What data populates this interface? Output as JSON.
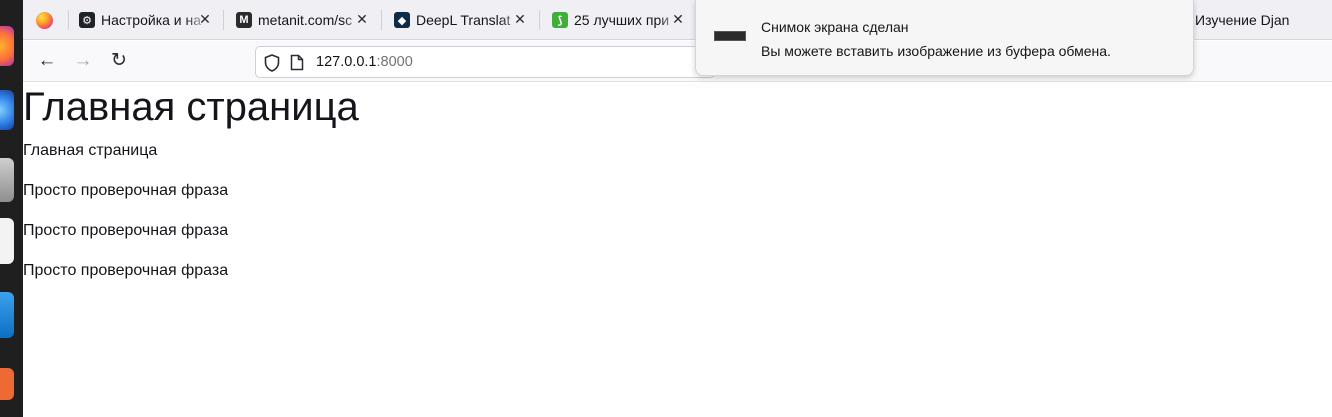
{
  "browser": {
    "tabs": [
      {
        "title": "Настройка и на",
        "icon": "github-icon",
        "favicon_color": "#1f2328",
        "favicon_glyph": "⚙"
      },
      {
        "title": "metanit.com/sc",
        "icon": "metanit-icon",
        "favicon_color": "#2b2b2b",
        "favicon_glyph": "M"
      },
      {
        "title": "DeepL Translat",
        "icon": "deepl-icon",
        "favicon_color": "#0f2b46",
        "favicon_glyph": "◆"
      },
      {
        "title": "25 лучших при",
        "icon": "leaf-icon",
        "favicon_color": "#3fae3b",
        "favicon_glyph": "⟆"
      }
    ],
    "right_tab": {
      "title": "Изучение Djan",
      "icon": "youtube-icon",
      "favicon_color": "#ff0000"
    },
    "close_glyph": "✕",
    "nav": {
      "back": "←",
      "forward": "→",
      "reload": "↻"
    },
    "url": {
      "host": "127.0.0.1",
      "port": ":8000"
    }
  },
  "notification": {
    "title": "Снимок экрана сделан",
    "body": "Вы можете вставить изображение из буфера обмена."
  },
  "page": {
    "heading": "Главная страница",
    "paragraphs": [
      "Главная страница",
      "Просто проверочная фраза",
      "Просто проверочная фраза",
      "Просто проверочная фраза"
    ]
  }
}
